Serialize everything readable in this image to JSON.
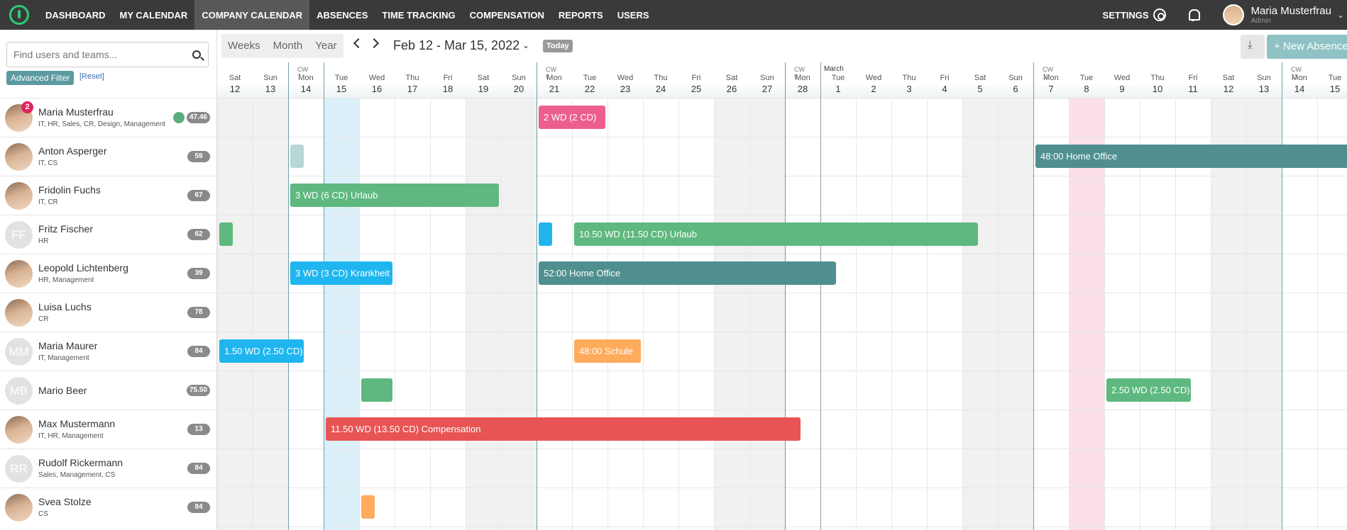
{
  "nav": {
    "items": [
      "DASHBOARD",
      "MY CALENDAR",
      "COMPANY CALENDAR",
      "ABSENCES",
      "TIME TRACKING",
      "COMPENSATION",
      "REPORTS",
      "USERS"
    ],
    "active": "COMPANY CALENDAR",
    "settings_label": "SETTINGS",
    "user_name": "Maria Musterfrau",
    "user_role": "Admin"
  },
  "sidebar": {
    "search_placeholder": "Find users and teams...",
    "advanced_filter": "Advanced Filter",
    "reset": "[Reset]",
    "users": [
      {
        "name": "Maria Musterfrau",
        "teams": "IT, HR, Sales, CR, Design, Management",
        "badge": "47.46",
        "avatar": "photo",
        "notification": "2",
        "online": true
      },
      {
        "name": "Anton Asperger",
        "teams": "IT, CS",
        "badge": "59",
        "avatar": "photo"
      },
      {
        "name": "Fridolin Fuchs",
        "teams": "IT, CR",
        "badge": "67",
        "avatar": "photo"
      },
      {
        "name": "Fritz Fischer",
        "teams": "HR",
        "badge": "62",
        "avatar": "FF"
      },
      {
        "name": "Leopold Lichtenberg",
        "teams": "HR, Management",
        "badge": "39",
        "avatar": "photo"
      },
      {
        "name": "Luisa Luchs",
        "teams": "CR",
        "badge": "78",
        "avatar": "photo"
      },
      {
        "name": "Maria Maurer",
        "teams": "IT, Management",
        "badge": "84",
        "avatar": "MM"
      },
      {
        "name": "Mario Beer",
        "teams": "",
        "badge": "75.50",
        "avatar": "MB"
      },
      {
        "name": "Max Mustermann",
        "teams": "IT, HR, Management",
        "badge": "13",
        "avatar": "photo"
      },
      {
        "name": "Rudolf Rickermann",
        "teams": "Sales, Management, CS",
        "badge": "84",
        "avatar": "RR"
      },
      {
        "name": "Svea Stolze",
        "teams": "CS",
        "badge": "84",
        "avatar": "photo"
      }
    ]
  },
  "toolbar": {
    "views": [
      "Weeks",
      "Month",
      "Year"
    ],
    "date_range": "Feb 12 - Mar 15, 2022",
    "today": "Today",
    "new_absence": "+ New Absence"
  },
  "calendar": {
    "days": [
      {
        "dw": "Sat",
        "dn": "12",
        "we": true
      },
      {
        "dw": "Sun",
        "dn": "13",
        "we": true
      },
      {
        "dw": "Mon",
        "dn": "14",
        "cw": "CW 7"
      },
      {
        "dw": "Tue",
        "dn": "15",
        "today": true
      },
      {
        "dw": "Wed",
        "dn": "16"
      },
      {
        "dw": "Thu",
        "dn": "17"
      },
      {
        "dw": "Fri",
        "dn": "18"
      },
      {
        "dw": "Sat",
        "dn": "19",
        "we": true
      },
      {
        "dw": "Sun",
        "dn": "20",
        "we": true
      },
      {
        "dw": "Mon",
        "dn": "21",
        "cw": "CW 8"
      },
      {
        "dw": "Tue",
        "dn": "22"
      },
      {
        "dw": "Wed",
        "dn": "23"
      },
      {
        "dw": "Thu",
        "dn": "24"
      },
      {
        "dw": "Fri",
        "dn": "25"
      },
      {
        "dw": "Sat",
        "dn": "26",
        "we": true
      },
      {
        "dw": "Sun",
        "dn": "27",
        "we": true
      },
      {
        "dw": "Mon",
        "dn": "28",
        "cw": "CW 9"
      },
      {
        "dw": "Tue",
        "dn": "1",
        "month": "March"
      },
      {
        "dw": "Wed",
        "dn": "2"
      },
      {
        "dw": "Thu",
        "dn": "3"
      },
      {
        "dw": "Fri",
        "dn": "4"
      },
      {
        "dw": "Sat",
        "dn": "5",
        "we": true
      },
      {
        "dw": "Sun",
        "dn": "6",
        "we": true
      },
      {
        "dw": "Mon",
        "dn": "7",
        "cw": "CW 10"
      },
      {
        "dw": "Tue",
        "dn": "8",
        "holiday": true
      },
      {
        "dw": "Wed",
        "dn": "9"
      },
      {
        "dw": "Thu",
        "dn": "10"
      },
      {
        "dw": "Fri",
        "dn": "11"
      },
      {
        "dw": "Sat",
        "dn": "12",
        "we": true
      },
      {
        "dw": "Sun",
        "dn": "13",
        "we": true
      },
      {
        "dw": "Mon",
        "dn": "14",
        "cw": "CW 11"
      },
      {
        "dw": "Tue",
        "dn": "15"
      }
    ],
    "bars": [
      {
        "row": 0,
        "start": 9,
        "days": 2,
        "label": "2 WD (2 CD)",
        "color": "#ec5f8c"
      },
      {
        "row": 1,
        "start": 23,
        "days": 9,
        "label": "48:00 Home Office",
        "color": "#4f8f8f"
      },
      {
        "row": 1,
        "start": 2,
        "days": 0.5,
        "label": "",
        "color": "#b8d6d6"
      },
      {
        "row": 2,
        "start": 2,
        "days": 6,
        "label": "3 WD (6 CD) Urlaub",
        "color": "#5eb87f"
      },
      {
        "row": 3,
        "start": 0,
        "days": 0.5,
        "label": "",
        "color": "#5eb87f"
      },
      {
        "row": 3,
        "start": 9,
        "days": 0.5,
        "label": "",
        "color": "#1fb6f0"
      },
      {
        "row": 3,
        "start": 10,
        "days": 11.5,
        "label": "10.50 WD (11.50 CD) Urlaub",
        "color": "#5eb87f"
      },
      {
        "row": 4,
        "start": 2,
        "days": 3,
        "label": "3 WD (3 CD) Krankheit",
        "color": "#1fb6f0"
      },
      {
        "row": 4,
        "start": 9,
        "days": 8.5,
        "label": "52:00 Home Office",
        "color": "#4f8f8f"
      },
      {
        "row": 6,
        "start": 0,
        "days": 2.5,
        "label": "1.50 WD (2.50 CD)",
        "color": "#1fb6f0"
      },
      {
        "row": 6,
        "start": 10,
        "days": 2,
        "label": "48:00 Schule",
        "color": "#ffab5c"
      },
      {
        "row": 7,
        "start": 4,
        "days": 1,
        "label": "",
        "color": "#5eb87f"
      },
      {
        "row": 7,
        "start": 25,
        "days": 2.5,
        "label": "2.50 WD (2.50 CD)",
        "color": "#5eb87f"
      },
      {
        "row": 8,
        "start": 3,
        "days": 13.5,
        "label": "11.50 WD (13.50 CD) Compensation",
        "color": "#e85454"
      },
      {
        "row": 10,
        "start": 4,
        "days": 0.5,
        "label": "",
        "color": "#ffab5c"
      }
    ]
  }
}
